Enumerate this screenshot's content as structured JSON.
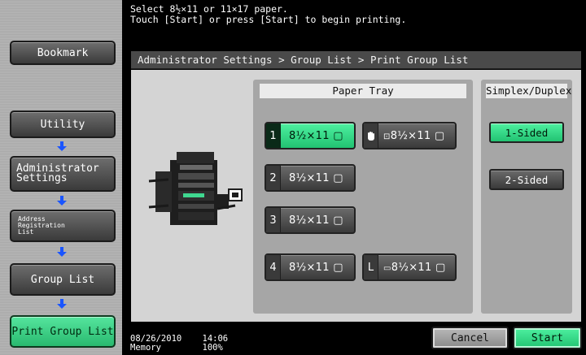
{
  "message": {
    "line1": "Select 8½×11 or 11×17 paper.",
    "line2": "Touch [Start] or press [Start] to begin printing."
  },
  "left_nav": {
    "bookmark": "Bookmark",
    "utility": "Utility",
    "admin_settings": "Administrator\nSettings",
    "address_registration": "Address\nRegistration\nList",
    "group_list": "Group List",
    "print_group_list": "Print Group List"
  },
  "breadcrumb": "Administrator Settings > Group List > Print Group List",
  "paper_tray": {
    "header": "Paper Tray",
    "trays": [
      {
        "num": "1",
        "label": "8½×11 ▢",
        "selected": true
      },
      {
        "num": "",
        "label": "8½×11 ▢",
        "selected": false,
        "kind": "manual-bypass"
      },
      {
        "num": "2",
        "label": "8½×11 ▢",
        "selected": false
      },
      {
        "num": "3",
        "label": "8½×11 ▢",
        "selected": false
      },
      {
        "num": "4",
        "label": "8½×11 ▢",
        "selected": false
      },
      {
        "num": "L",
        "label": "8½×11 ▢",
        "selected": false,
        "kind": "large-capacity"
      }
    ]
  },
  "duplex": {
    "header": "Simplex/Duplex",
    "options": [
      {
        "label": "1-Sided",
        "selected": true
      },
      {
        "label": "2-Sided",
        "selected": false
      }
    ]
  },
  "status": {
    "date": "08/26/2010",
    "time": "14:06",
    "memory_label": "Memory",
    "memory_value": "100%"
  },
  "buttons": {
    "cancel": "Cancel",
    "start": "Start"
  },
  "colors": {
    "selected_green": "#2fd583",
    "arrow_blue": "#1a55ff"
  }
}
